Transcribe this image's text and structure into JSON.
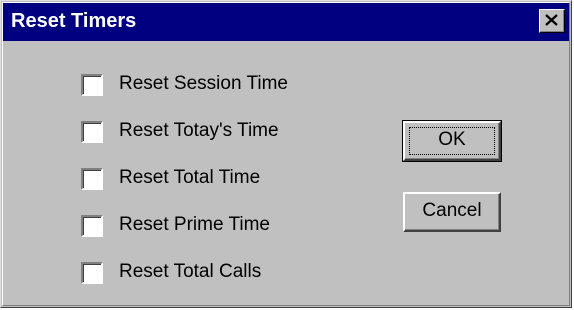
{
  "window": {
    "title": "Reset Timers",
    "close_icon": "close-icon"
  },
  "options": [
    {
      "label": "Reset Session Time",
      "checked": false
    },
    {
      "label": "Reset Totay's Time",
      "checked": false
    },
    {
      "label": "Reset Total Time",
      "checked": false
    },
    {
      "label": "Reset Prime Time",
      "checked": false
    },
    {
      "label": "Reset Total Calls",
      "checked": false
    }
  ],
  "buttons": {
    "ok_label": "OK",
    "cancel_label": "Cancel"
  },
  "colors": {
    "title_bar": "#000080",
    "dialog_face": "#c0c0c0"
  }
}
